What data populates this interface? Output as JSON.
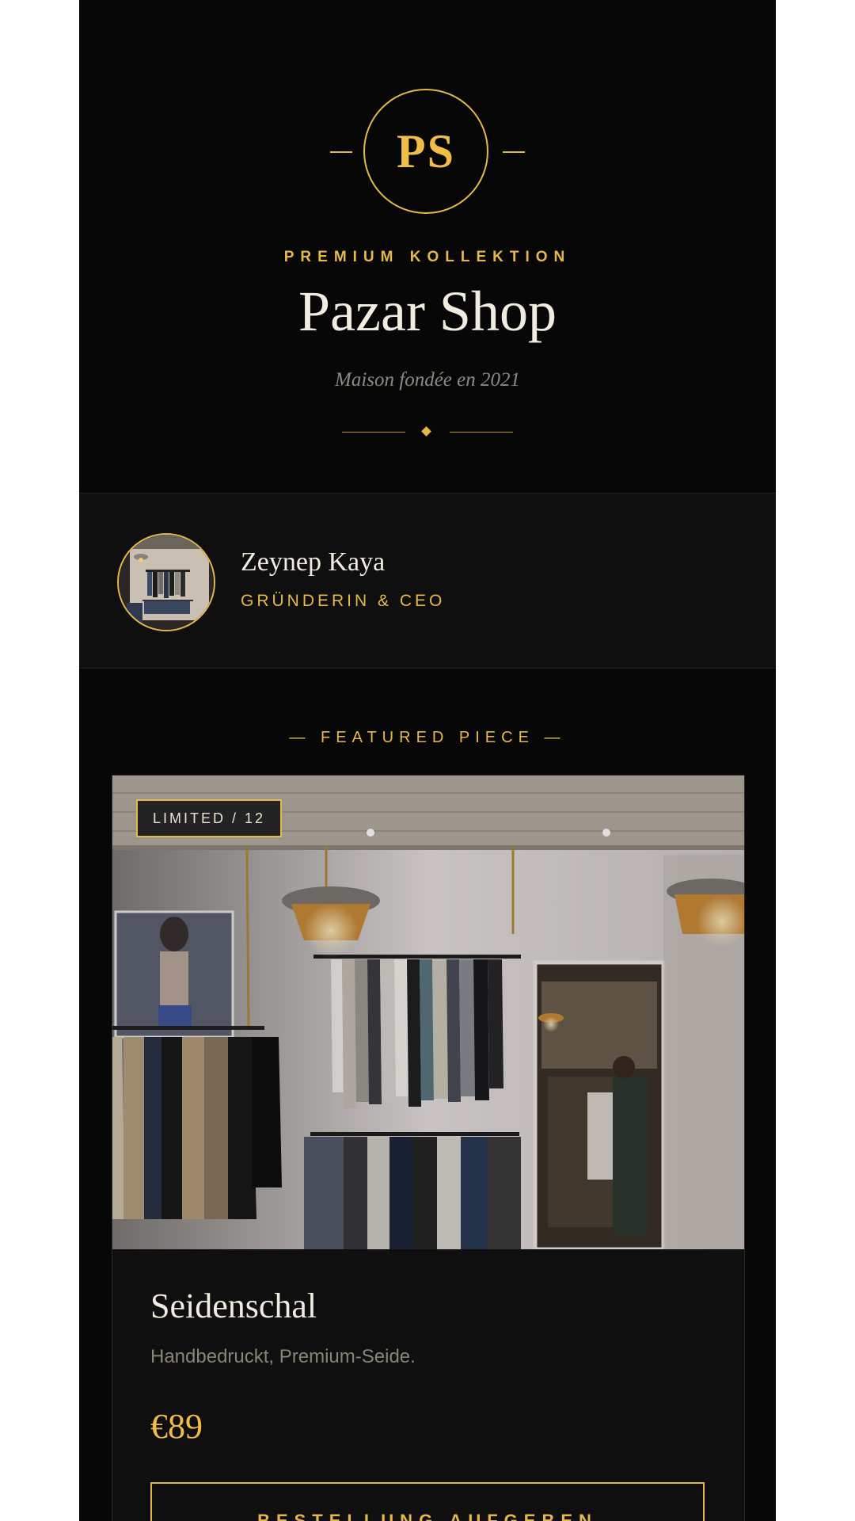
{
  "brand": {
    "monogram": "PS",
    "kicker": "PREMIUM KOLLEKTION",
    "name": "Pazar Shop",
    "tagline": "Maison fondée en 2021"
  },
  "founder": {
    "name": "Zeynep Kaya",
    "role": "GRÜNDERIN & CEO"
  },
  "featured": {
    "label": "— FEATURED PIECE —",
    "badge": "LIMITED / 12",
    "product_name": "Seidenschal",
    "description": "Handbedruckt, Premium-Seide.",
    "price": "€89",
    "cta": "BESTELLUNG AUFGEBEN"
  },
  "colors": {
    "accent": "#e6b84a",
    "background": "#070707",
    "card": "#0f0f0f",
    "text": "#f1ece0"
  }
}
